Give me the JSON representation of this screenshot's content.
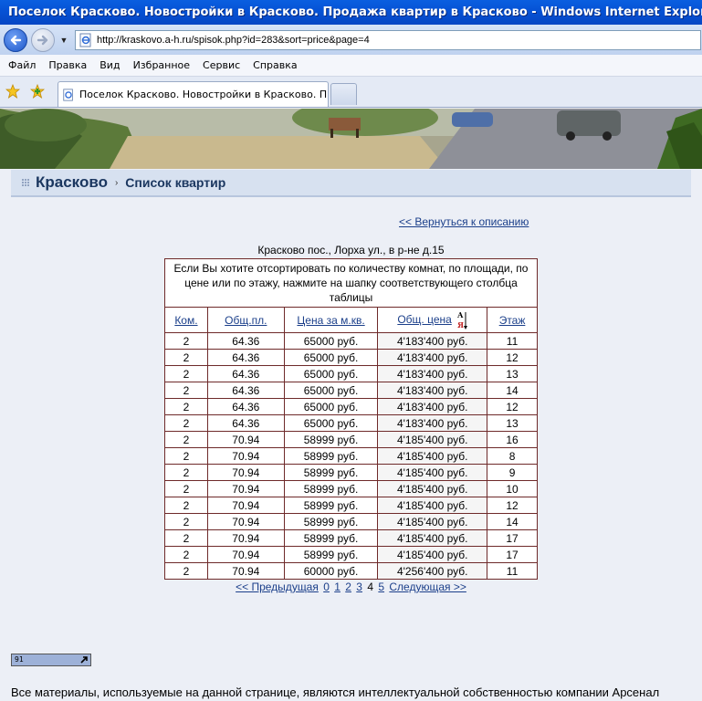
{
  "window": {
    "title": "Поселок Красково. Новостройки в Красково. Продажа квартир в Красково - Windows Internet Explorer"
  },
  "address_bar": {
    "url": "http://kraskovo.a-h.ru/spisok.php?id=283&sort=price&page=4"
  },
  "menu": [
    "Файл",
    "Правка",
    "Вид",
    "Избранное",
    "Сервис",
    "Справка"
  ],
  "tab": {
    "label": "Поселок Красково. Новостройки в Красково. Прод..."
  },
  "heading": {
    "site": "Красково",
    "separator": "›",
    "section": "Список квартир"
  },
  "back_link": "<< Вернуться к описанию",
  "address": "Красково пос., Лорха ул., в р-не д.15",
  "table": {
    "note": "Если Вы хотите отсортировать по количеству комнат, по площади, по цене или по этажу, нажмите на шапку соответствующего столбца таблицы",
    "headers": [
      "Ком.",
      "Общ.пл.",
      "Цена за м.кв.",
      "Общ. цена",
      "Этаж"
    ],
    "sort_letters": {
      "top": "А",
      "bottom": "Я"
    },
    "rows": [
      [
        "2",
        "64.36",
        "65000 руб.",
        "4'183'400 руб.",
        "11"
      ],
      [
        "2",
        "64.36",
        "65000 руб.",
        "4'183'400 руб.",
        "12"
      ],
      [
        "2",
        "64.36",
        "65000 руб.",
        "4'183'400 руб.",
        "13"
      ],
      [
        "2",
        "64.36",
        "65000 руб.",
        "4'183'400 руб.",
        "14"
      ],
      [
        "2",
        "64.36",
        "65000 руб.",
        "4'183'400 руб.",
        "12"
      ],
      [
        "2",
        "64.36",
        "65000 руб.",
        "4'183'400 руб.",
        "13"
      ],
      [
        "2",
        "70.94",
        "58999 руб.",
        "4'185'400 руб.",
        "16"
      ],
      [
        "2",
        "70.94",
        "58999 руб.",
        "4'185'400 руб.",
        "8"
      ],
      [
        "2",
        "70.94",
        "58999 руб.",
        "4'185'400 руб.",
        "9"
      ],
      [
        "2",
        "70.94",
        "58999 руб.",
        "4'185'400 руб.",
        "10"
      ],
      [
        "2",
        "70.94",
        "58999 руб.",
        "4'185'400 руб.",
        "12"
      ],
      [
        "2",
        "70.94",
        "58999 руб.",
        "4'185'400 руб.",
        "14"
      ],
      [
        "2",
        "70.94",
        "58999 руб.",
        "4'185'400 руб.",
        "17"
      ],
      [
        "2",
        "70.94",
        "58999 руб.",
        "4'185'400 руб.",
        "17"
      ],
      [
        "2",
        "70.94",
        "60000 руб.",
        "4'256'400 руб.",
        "11"
      ]
    ]
  },
  "pager": {
    "prev": "<< Предыдущая",
    "pages": [
      "0",
      "1",
      "2",
      "3",
      "4",
      "5"
    ],
    "current": "4",
    "next": "Следующая >>"
  },
  "counter": {
    "value": "91"
  },
  "footer": "Все материалы, используемые на данной странице, являются интеллектуальной собственностью компании Арсенал",
  "colors": {
    "titlebar": "#0653D6",
    "heading_bg": "#D7E1F0",
    "heading_text": "#1B3760",
    "link": "#1B3F8A",
    "table_border": "#6E2A2A",
    "page_bg": "#ECEFF6"
  }
}
